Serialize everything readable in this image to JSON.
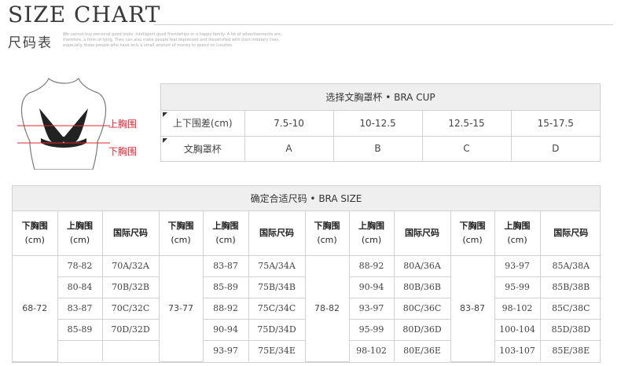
{
  "header": {
    "title": "SIZE CHART",
    "subtitle": "尺码表",
    "note": "We cannot buy personal good looks, intelligent good friendships or a happy family. A lot of advertisements are, therefore, a form of lying. They can also make people feel depressed and dissatisfied with their ordinary lives, especially those people who have only a small amount of money to spend on luxuries."
  },
  "figure": {
    "upper_label": "上胸围",
    "lower_label": "下胸围",
    "label_color": "#e0242e"
  },
  "cup_table": {
    "caption": "选择文胸罩杯 • BRA CUP",
    "diff_label": "上下围差(cm)",
    "cup_label": "文胸罩杯",
    "columns": [
      {
        "diff": "7.5-10",
        "cup": "A"
      },
      {
        "diff": "10-12.5",
        "cup": "B"
      },
      {
        "diff": "12.5-15",
        "cup": "C"
      },
      {
        "diff": "15-17.5",
        "cup": "D"
      }
    ]
  },
  "size_table": {
    "caption": "确定合适尺码 • BRA SIZE",
    "header_under": "下胸围",
    "header_upper": "上胸围",
    "header_unit": "(cm)",
    "header_intl": "国际尺码",
    "groups": [
      {
        "under": "68-72",
        "rows": [
          {
            "upper": "78-82",
            "intl": "70A/32A"
          },
          {
            "upper": "80-84",
            "intl": "70B/32B"
          },
          {
            "upper": "83-87",
            "intl": "70C/32C"
          },
          {
            "upper": "85-89",
            "intl": "70D/32D"
          },
          {
            "upper": "",
            "intl": ""
          }
        ]
      },
      {
        "under": "73-77",
        "rows": [
          {
            "upper": "83-87",
            "intl": "75A/34A"
          },
          {
            "upper": "85-89",
            "intl": "75B/34B"
          },
          {
            "upper": "88-92",
            "intl": "75C/34C"
          },
          {
            "upper": "90-94",
            "intl": "75D/34D"
          },
          {
            "upper": "93-97",
            "intl": "75E/34E"
          }
        ]
      },
      {
        "under": "78-82",
        "rows": [
          {
            "upper": "88-92",
            "intl": "80A/36A"
          },
          {
            "upper": "90-94",
            "intl": "80B/36B"
          },
          {
            "upper": "93-97",
            "intl": "80C/36C"
          },
          {
            "upper": "95-99",
            "intl": "80D/36D"
          },
          {
            "upper": "98-102",
            "intl": "80E/36E"
          }
        ]
      },
      {
        "under": "83-87",
        "rows": [
          {
            "upper": "93-97",
            "intl": "85A/38A"
          },
          {
            "upper": "95-99",
            "intl": "85B/38B"
          },
          {
            "upper": "98-102",
            "intl": "85C/38C"
          },
          {
            "upper": "100-104",
            "intl": "85D/38D"
          },
          {
            "upper": "103-107",
            "intl": "85E/38E"
          }
        ]
      }
    ]
  }
}
